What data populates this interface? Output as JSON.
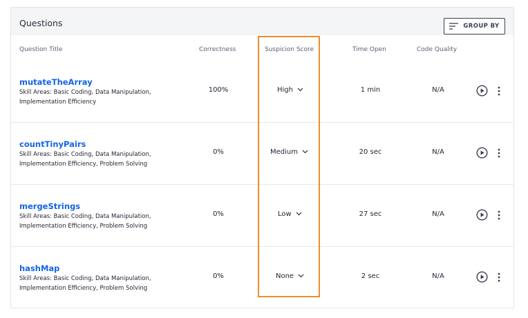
{
  "panel": {
    "title": "Questions",
    "group_by_label": "GROUP BY"
  },
  "columns": {
    "title": "Question Title",
    "correctness": "Correctness",
    "suspicion": "Suspicion Score",
    "time_open": "Time Open",
    "code_quality": "Code Quality"
  },
  "rows": [
    {
      "title": "mutateTheArray",
      "skills_line1": "Skill Areas: Basic Coding, Data Manipulation,",
      "skills_line2": "Implementation Efficiency",
      "correctness": "100%",
      "suspicion": "High",
      "time_open": "1 min",
      "code_quality": "N/A"
    },
    {
      "title": "countTinyPairs",
      "skills_line1": "Skill Areas: Basic Coding, Data Manipulation,",
      "skills_line2": "Implementation Efficiency, Problem Solving",
      "correctness": "0%",
      "suspicion": "Medium",
      "time_open": "20 sec",
      "code_quality": "N/A"
    },
    {
      "title": "mergeStrings",
      "skills_line1": "Skill Areas: Basic Coding, Data Manipulation,",
      "skills_line2": "Implementation Efficiency, Problem Solving",
      "correctness": "0%",
      "suspicion": "Low",
      "time_open": "27 sec",
      "code_quality": "N/A"
    },
    {
      "title": "hashMap",
      "skills_line1": "Skill Areas: Basic Coding, Data Manipulation,",
      "skills_line2": "Implementation Efficiency, Problem Solving",
      "correctness": "0%",
      "suspicion": "None",
      "time_open": "2 sec",
      "code_quality": "N/A"
    }
  ],
  "icons": {
    "group_by": "filter-lines-icon",
    "play": "play-circle-icon",
    "more": "more-vertical-icon",
    "dropdown": "chevron-down-icon"
  },
  "colors": {
    "link": "#1464e6",
    "highlight": "#f28c28",
    "header_bg": "#f4f5f7"
  }
}
